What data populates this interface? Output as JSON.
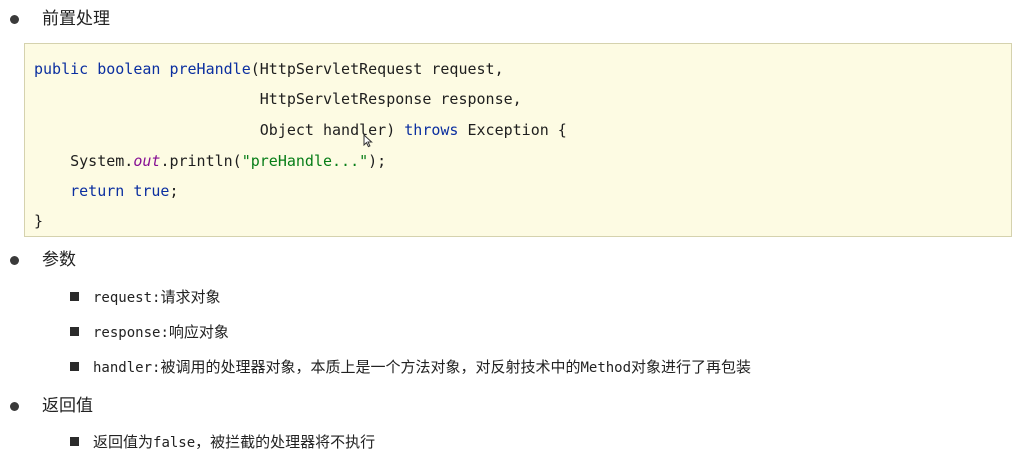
{
  "section1": {
    "title": "前置处理"
  },
  "code": {
    "l1": {
      "public": "public",
      "boolean": "boolean",
      "name": "preHandle",
      "rest": "(HttpServletRequest request,"
    },
    "l2": {
      "text": "HttpServletResponse response,"
    },
    "l3": {
      "before": "Object handler) ",
      "throws": "throws",
      "after": " Exception {"
    },
    "l4": {
      "before": "System.",
      "field": "out",
      "mid": ".println(",
      "str": "\"preHandle...\"",
      "after": ");"
    },
    "l5": {
      "return": "return",
      "true": "true",
      "after": ";"
    },
    "l6": {
      "text": "}"
    }
  },
  "section2": {
    "title": "参数",
    "items": [
      {
        "code": "request",
        "sep": ":",
        "text": "请求对象"
      },
      {
        "code": "response",
        "sep": ":",
        "text": "响应对象"
      },
      {
        "code": "handler",
        "sep": ":",
        "text": "被调用的处理器对象，本质上是一个方法对象，对反射技术中的",
        "code2": "Method",
        "text2": "对象进行了再包装"
      }
    ]
  },
  "section3": {
    "title": "返回值",
    "items": [
      {
        "text": "返回值为",
        "code": "false",
        "text2": "，被拦截的处理器将不执行"
      }
    ]
  },
  "colors": {
    "keyword": "#0b2fa0",
    "field": "#871094",
    "string": "#067d17",
    "code_bg": "#fdfbe3"
  },
  "icons": {
    "cursor": "mouse-pointer-icon"
  }
}
